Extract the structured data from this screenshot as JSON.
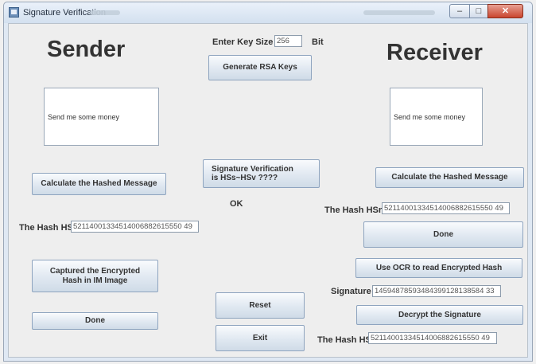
{
  "window": {
    "title": "Signature Verification",
    "minimize_glyph": "–",
    "maximize_glyph": "□",
    "close_glyph": "✕"
  },
  "sender": {
    "heading": "Sender",
    "message": "Send me some money",
    "calc_hash_button": "Calculate the Hashed Message",
    "hash_label": "The Hash HSs",
    "hash_value": "52114001334514006882615550 49",
    "capture_button_line1": "Captured the Encrypted",
    "capture_button_line2": "Hash in IM Image",
    "done_button": "Done"
  },
  "center": {
    "key_size_label": "Enter Key Size",
    "key_size_value": "256",
    "key_size_unit": "Bit",
    "generate_button": "Generate RSA Keys",
    "verify_button_line1": "Signature Verification",
    "verify_button_line2": "is HSs~HSv ????",
    "status": "OK",
    "reset_button": "Reset",
    "exit_button": "Exit"
  },
  "receiver": {
    "heading": "Receiver",
    "message": "Send me some money",
    "calc_hash_button": "Calculate the Hashed Message",
    "hash_label": "The Hash HSr",
    "hash_value": "52114001334514006882615550 49",
    "done_button": "Done",
    "ocr_button": "Use OCR to read Encrypted Hash",
    "signature_label": "Signature",
    "signature_value": "14594878593484399128138584 33",
    "decrypt_button": "Decrypt the Signature",
    "hash_hss_label": "The Hash HSs",
    "hash_hss_value": "52114001334514006882615550 49"
  }
}
